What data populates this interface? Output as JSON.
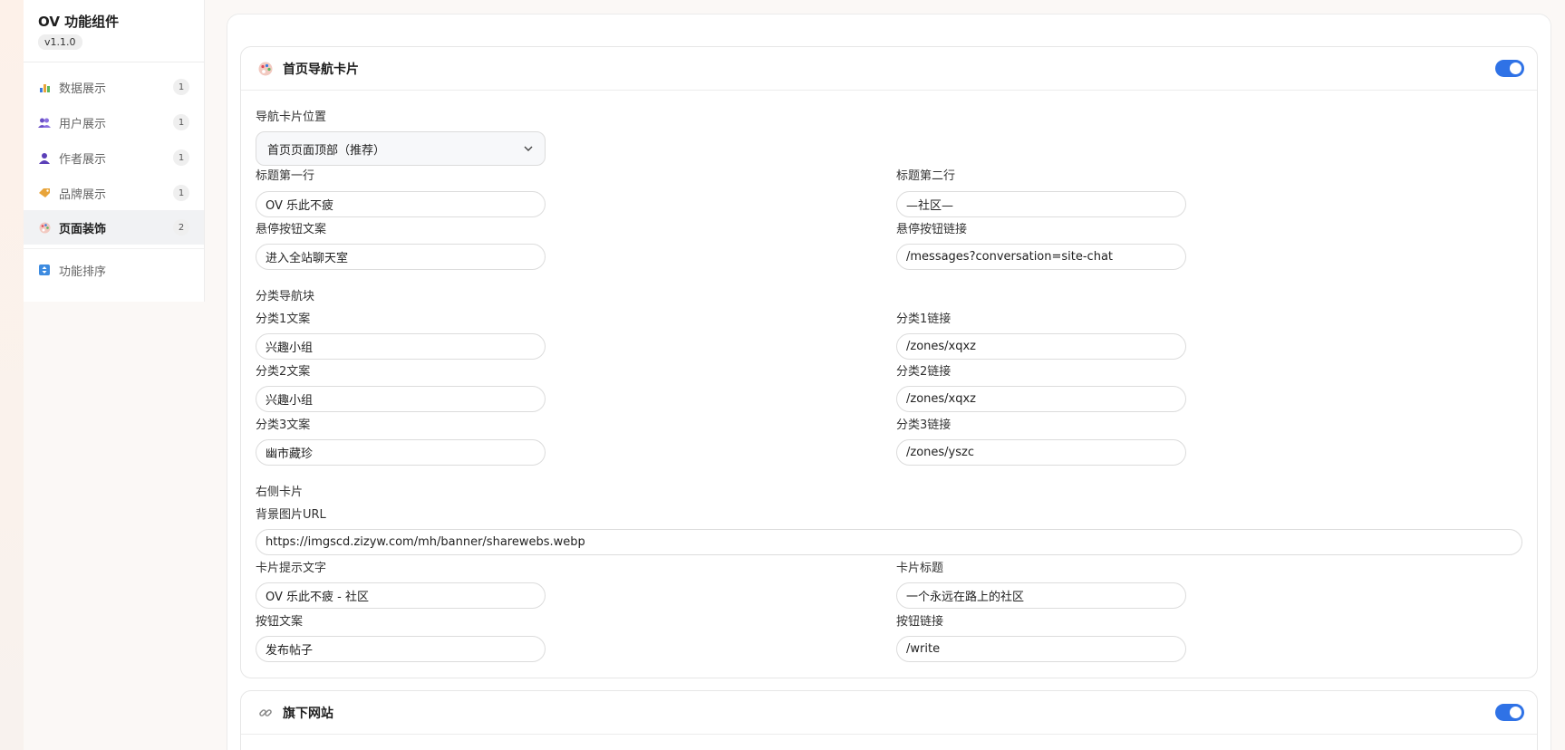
{
  "app": {
    "title": "OV 功能组件",
    "version": "v1.1.0"
  },
  "sidebar": {
    "items": [
      {
        "label": "数据展示",
        "count": "1",
        "icon": "bar-chart-icon",
        "color": "#3d7be0"
      },
      {
        "label": "用户展示",
        "count": "1",
        "icon": "users-icon",
        "color": "#7b5cd6"
      },
      {
        "label": "作者展示",
        "count": "1",
        "icon": "person-icon",
        "color": "#5b3fb8"
      },
      {
        "label": "品牌展示",
        "count": "1",
        "icon": "tag-icon",
        "color": "#e8a43a"
      },
      {
        "label": "页面装饰",
        "count": "2",
        "icon": "palette-icon",
        "color": "#e06a7a"
      }
    ],
    "sort_item": {
      "label": "功能排序",
      "icon": "sort-arrows-icon",
      "color": "#3d8be0"
    }
  },
  "card_home_nav": {
    "title": "首页导航卡片",
    "icon": "palette-icon",
    "enabled": true,
    "position_label": "导航卡片位置",
    "position_value": "首页页面顶部（推荐）",
    "title_line1_label": "标题第一行",
    "title_line1_value": "OV 乐此不疲",
    "title_line2_label": "标题第二行",
    "title_line2_value": "—社区—",
    "hover_btn_text_label": "悬停按钮文案",
    "hover_btn_text_value": "进入全站聊天室",
    "hover_btn_link_label": "悬停按钮链接",
    "hover_btn_link_value": "/messages?conversation=site-chat",
    "category_section": "分类导航块",
    "cat1_text_label": "分类1文案",
    "cat1_text_value": "兴趣小组",
    "cat1_link_label": "分类1链接",
    "cat1_link_value": "/zones/xqxz",
    "cat2_text_label": "分类2文案",
    "cat2_text_value": "兴趣小组",
    "cat2_link_label": "分类2链接",
    "cat2_link_value": "/zones/xqxz",
    "cat3_text_label": "分类3文案",
    "cat3_text_value": "幽市藏珍",
    "cat3_link_label": "分类3链接",
    "cat3_link_value": "/zones/yszc",
    "right_card_section": "右侧卡片",
    "bg_url_label": "背景图片URL",
    "bg_url_value": "https://imgscd.zizyw.com/mh/banner/sharewebs.webp",
    "card_hint_label": "卡片提示文字",
    "card_hint_value": "OV 乐此不疲 - 社区",
    "card_title_label": "卡片标题",
    "card_title_value": "一个永远在路上的社区",
    "btn_text_label": "按钮文案",
    "btn_text_value": "发布帖子",
    "btn_link_label": "按钮链接",
    "btn_link_value": "/write"
  },
  "card_sites": {
    "title": "旗下网站",
    "icon": "link-icon",
    "enabled": true
  },
  "colors": {
    "accent": "#2f72e6"
  }
}
